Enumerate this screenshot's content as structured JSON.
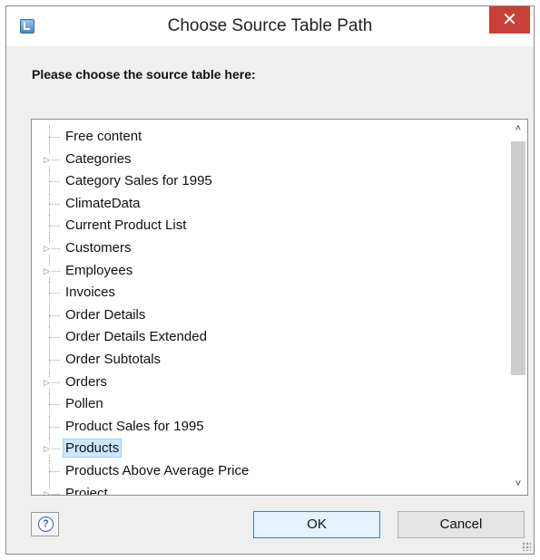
{
  "window": {
    "title": "Choose Source Table Path",
    "close_glyph": "✕"
  },
  "prompt": "Please choose the source table here:",
  "tree": {
    "items": [
      {
        "label": "Free content",
        "expandable": false,
        "selected": false
      },
      {
        "label": "Categories",
        "expandable": true,
        "selected": false
      },
      {
        "label": "Category Sales for 1995",
        "expandable": false,
        "selected": false
      },
      {
        "label": "ClimateData",
        "expandable": false,
        "selected": false
      },
      {
        "label": "Current Product List",
        "expandable": false,
        "selected": false
      },
      {
        "label": "Customers",
        "expandable": true,
        "selected": false
      },
      {
        "label": "Employees",
        "expandable": true,
        "selected": false
      },
      {
        "label": "Invoices",
        "expandable": false,
        "selected": false
      },
      {
        "label": "Order Details",
        "expandable": false,
        "selected": false
      },
      {
        "label": "Order Details Extended",
        "expandable": false,
        "selected": false
      },
      {
        "label": "Order Subtotals",
        "expandable": false,
        "selected": false
      },
      {
        "label": "Orders",
        "expandable": true,
        "selected": false
      },
      {
        "label": "Pollen",
        "expandable": false,
        "selected": false
      },
      {
        "label": "Product Sales for 1995",
        "expandable": false,
        "selected": false
      },
      {
        "label": "Products",
        "expandable": true,
        "selected": true
      },
      {
        "label": "Products Above Average Price",
        "expandable": false,
        "selected": false
      },
      {
        "label": "Project",
        "expandable": true,
        "selected": false
      }
    ],
    "expander_glyph": "▷",
    "scroll_up_glyph": "˄",
    "scroll_down_glyph": "˅"
  },
  "buttons": {
    "help_glyph": "?",
    "ok_label": "OK",
    "cancel_label": "Cancel"
  },
  "colors": {
    "close_button": "#c7403a",
    "selection_fill": "#cce8ff",
    "ok_border": "#3c7fb1"
  }
}
